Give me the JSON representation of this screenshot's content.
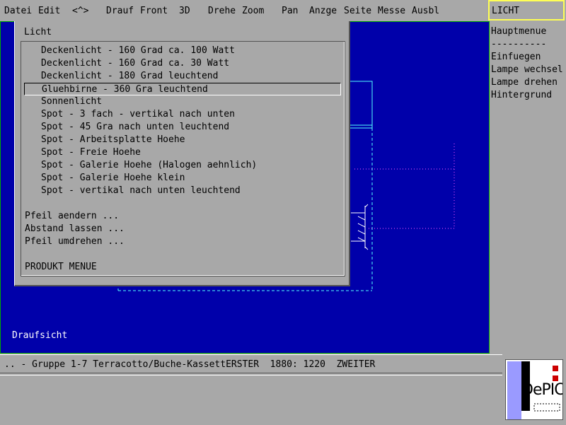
{
  "menubar": {
    "items": [
      "Datei",
      "Edit",
      "<^>",
      "Drauf",
      "Front",
      "3D",
      "Drehe",
      "Zoom",
      "Pan",
      "Anzge",
      "Seite",
      "Messe",
      "Ausbl"
    ]
  },
  "mode_title": "LICHT",
  "side_menu": {
    "items": [
      "Hauptmenue",
      "----------",
      "Einfuegen",
      "Lampe wechsel",
      "Lampe drehen",
      "Hintergrund"
    ]
  },
  "viewport": {
    "label": "Draufsicht",
    "colors": {
      "background": "#0000aa",
      "cyan": "#55ffff",
      "dotted": "#ff55ff"
    }
  },
  "popup": {
    "title": "Licht",
    "light_options": [
      "Deckenlicht - 160 Grad ca. 100 Watt",
      "Deckenlicht - 160 Grad ca. 30 Watt",
      "Deckenlicht - 180 Grad leuchtend",
      "Gluehbirne - 360 Gra leuchtend",
      "Sonnenlicht",
      "Spot - 3 fach - vertikal nach unten",
      "Spot - 45 Gra nach unten leuchtend",
      "Spot - Arbeitsplatte Hoehe",
      "Spot - Freie Hoehe",
      "Spot - Galerie Hoehe (Halogen aehnlich)",
      "Spot - Galerie Hoehe klein",
      "Spot - vertikal nach unten leuchtend"
    ],
    "selected_index": 3,
    "actions": [
      "Pfeil aendern ...",
      "Abstand lassen ...",
      "Pfeil umdrehen ..."
    ],
    "footer": "PRODUKT MENUE"
  },
  "status": {
    "text": ".. - Gruppe 1-7 Terracotto/Buche-KassettERSTER  1880: 1220  ZWEITER"
  },
  "logo": {
    "text": "DePICT"
  }
}
